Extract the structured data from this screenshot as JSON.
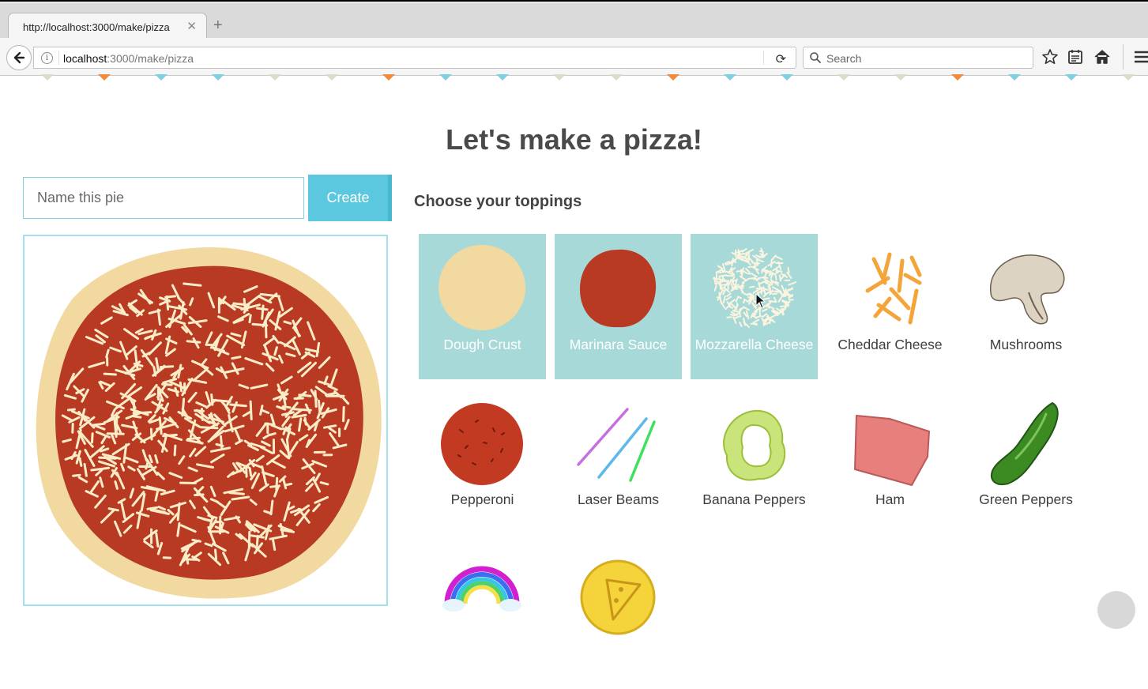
{
  "browser": {
    "tab_title": "http://localhost:3000/make/pizza",
    "tab_close": "✕",
    "new_tab": "+",
    "url_host": "localhost",
    "url_path": ":3000/make/pizza",
    "search_placeholder": "Search"
  },
  "page": {
    "title": "Let's make a pizza!",
    "name_placeholder": "Name this pie",
    "create_label": "Create",
    "toppings_heading": "Choose your toppings"
  },
  "toppings": [
    {
      "label": "Dough Crust",
      "selected": true,
      "icon": "dough-crust-icon"
    },
    {
      "label": "Marinara Sauce",
      "selected": true,
      "icon": "marinara-sauce-icon"
    },
    {
      "label": "Mozzarella Cheese",
      "selected": true,
      "icon": "mozzarella-cheese-icon"
    },
    {
      "label": "Cheddar Cheese",
      "selected": false,
      "icon": "cheddar-cheese-icon"
    },
    {
      "label": "Mushrooms",
      "selected": false,
      "icon": "mushroom-icon"
    },
    {
      "label": "Pepperoni",
      "selected": false,
      "icon": "pepperoni-icon"
    },
    {
      "label": "Laser Beams",
      "selected": false,
      "icon": "laser-beams-icon"
    },
    {
      "label": "Banana Peppers",
      "selected": false,
      "icon": "banana-pepper-icon"
    },
    {
      "label": "Ham",
      "selected": false,
      "icon": "ham-icon"
    },
    {
      "label": "Green Peppers",
      "selected": false,
      "icon": "green-pepper-icon"
    }
  ],
  "colors": {
    "accent": "#5bc8e0",
    "selected_tile": "#a8d9d9",
    "crust": "#f2d9a0",
    "sauce": "#b83a22",
    "cheese": "#fbecc8"
  }
}
